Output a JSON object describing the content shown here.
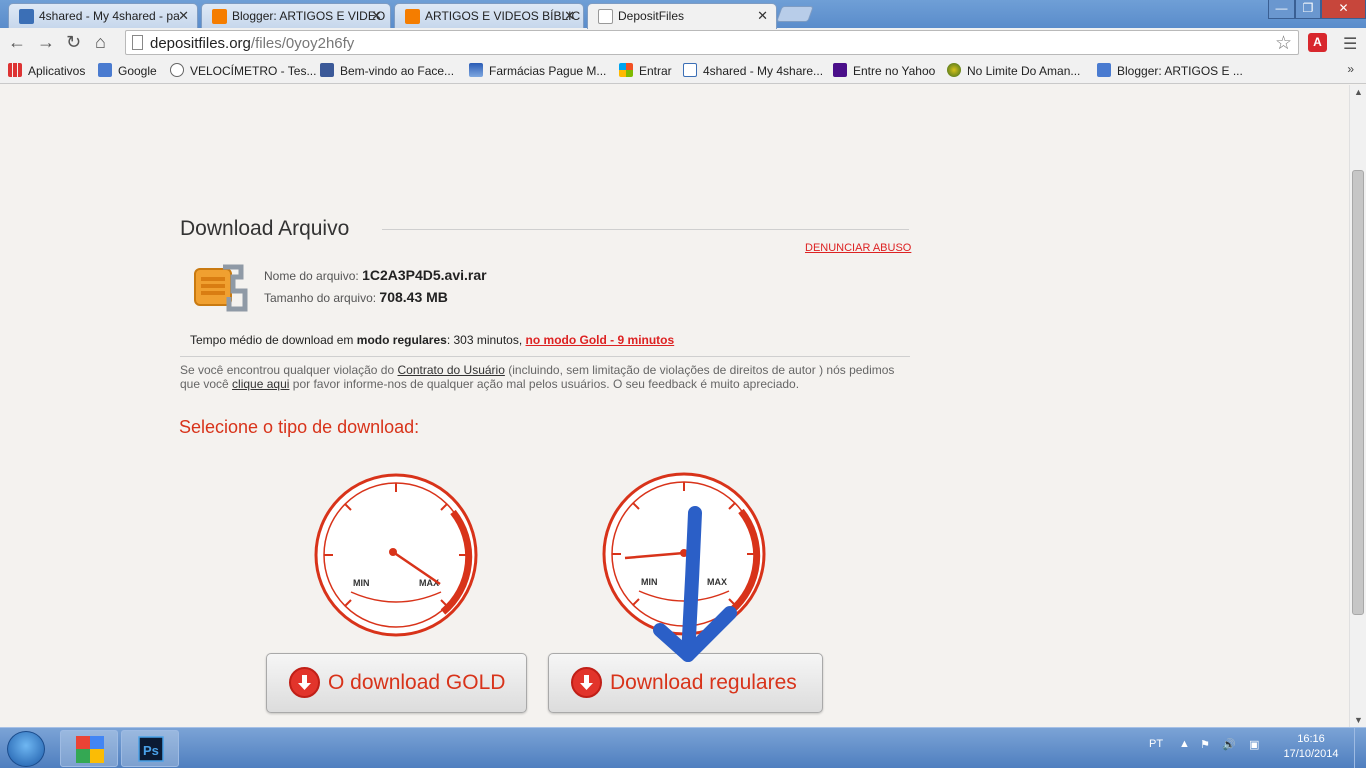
{
  "browser": {
    "tabs": [
      {
        "label": "4shared - My 4shared - pa",
        "active": false
      },
      {
        "label": "Blogger: ARTIGOS E VIDEO",
        "active": false
      },
      {
        "label": "ARTIGOS E VIDEOS BÍBLIC",
        "active": false
      },
      {
        "label": "DepositFiles",
        "active": true
      }
    ],
    "url_host": "depositfiles.org",
    "url_path": "/files/0yoy2h6fy",
    "extension_label": "A",
    "bookmarks": [
      {
        "label": "Aplicativos",
        "icon": "apps-grid-icon"
      },
      {
        "label": "Google",
        "icon": "google-icon"
      },
      {
        "label": "VELOCÍMETRO - Tes...",
        "icon": "speedometer-icon"
      },
      {
        "label": "Bem-vindo ao Face...",
        "icon": "facebook-icon"
      },
      {
        "label": "Farmácias Pague M...",
        "icon": "pharmacy-icon"
      },
      {
        "label": "Entrar",
        "icon": "windows-icon"
      },
      {
        "label": "4shared - My 4share...",
        "icon": "4shared-icon"
      },
      {
        "label": "Entre no Yahoo",
        "icon": "yahoo-icon"
      },
      {
        "label": "No Limite Do Aman...",
        "icon": "globe-icon"
      },
      {
        "label": "Blogger: ARTIGOS E ...",
        "icon": "google-icon"
      }
    ],
    "bookmarks_more": "»"
  },
  "page": {
    "heading": "Download Arquivo",
    "report_link": "DENUNCIAR ABUSO",
    "file_name_label": "Nome do arquivo:",
    "file_name": "1C2A3P4D5.avi.rar",
    "file_size_label": "Tamanho do arquivo:",
    "file_size": "708.43 MB",
    "avg_prefix": "Tempo médio de download em",
    "avg_mode": "modo regulares",
    "avg_time": ": 303 minutos,",
    "avg_gold_link": "no modo Gold - 9 minutos",
    "notice_1": "Se você encontrou qualquer violação do",
    "notice_link_1": "Contrato do Usuário",
    "notice_2": "(incluindo, sem limitação de violações de direitos de autor ) nós pedimos que você",
    "notice_link_2": "clique aqui",
    "notice_3": "por favor informe-nos de qualquer ação mal pelos usuários. O seu feedback é muito apreciado.",
    "select_title": "Selecione o tipo de download:",
    "gauge_min": "MIN",
    "gauge_max": "MAX",
    "gold_button": "O download GOLD",
    "regular_button": "Download regulares",
    "colors": {
      "accent_red": "#d8331a",
      "annotation_blue": "#2b5fc7"
    }
  },
  "taskbar": {
    "language": "PT",
    "time": "16:16",
    "date": "17/10/2014"
  }
}
